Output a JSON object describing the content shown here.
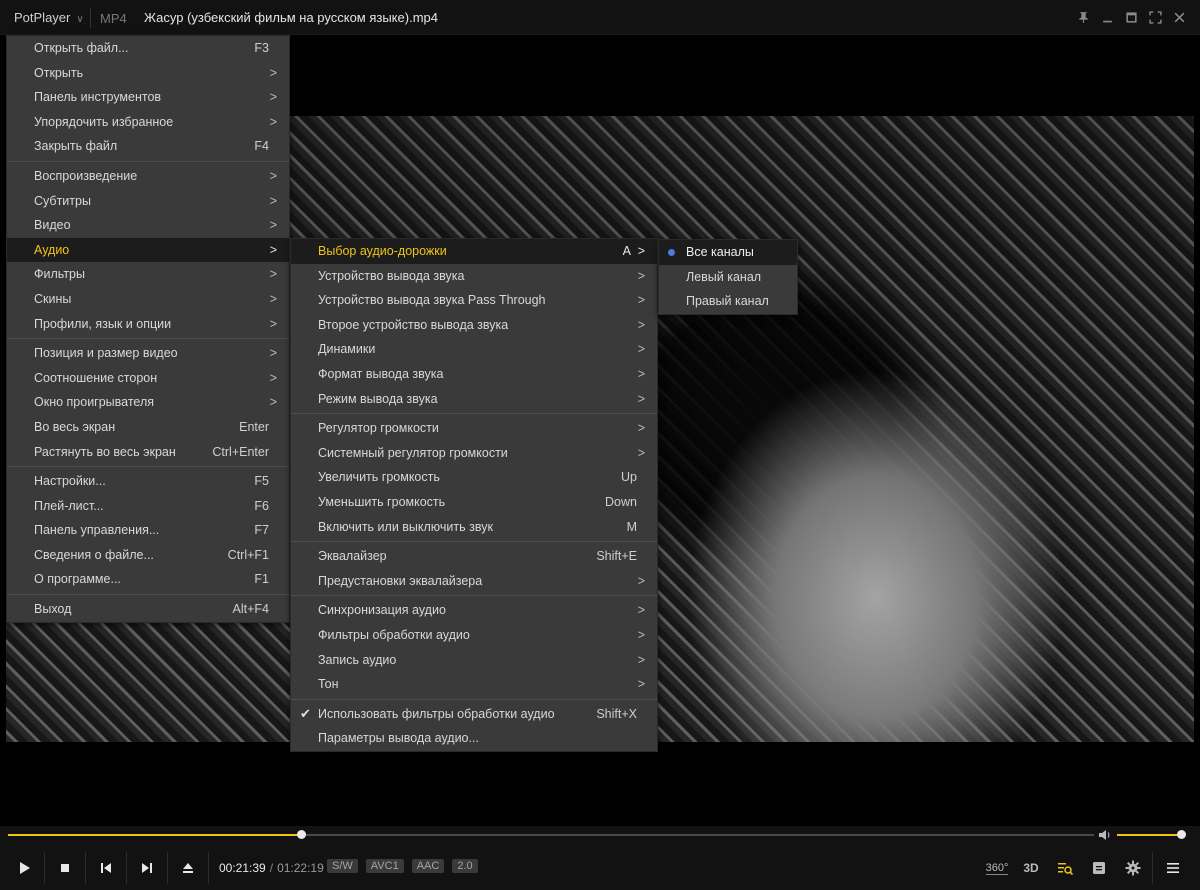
{
  "titlebar": {
    "app_name": "PotPlayer",
    "format": "MP4",
    "title": "Жасур (узбекский фильм на русском языке).mp4"
  },
  "main_menu": {
    "groups": [
      [
        {
          "label": "Открыть файл...",
          "shortcut": "F3"
        },
        {
          "label": "Открыть",
          "submenu": true
        },
        {
          "label": "Панель инструментов",
          "submenu": true
        },
        {
          "label": "Упорядочить избранное",
          "submenu": true
        },
        {
          "label": "Закрыть файл",
          "shortcut": "F4"
        }
      ],
      [
        {
          "label": "Воспроизведение",
          "submenu": true
        },
        {
          "label": "Субтитры",
          "submenu": true
        },
        {
          "label": "Видео",
          "submenu": true
        },
        {
          "label": "Аудио",
          "submenu": true,
          "active": true
        },
        {
          "label": "Фильтры",
          "submenu": true
        },
        {
          "label": "Скины",
          "submenu": true
        },
        {
          "label": "Профили, язык и опции",
          "submenu": true
        }
      ],
      [
        {
          "label": "Позиция и размер видео",
          "submenu": true
        },
        {
          "label": "Соотношение сторон",
          "submenu": true
        },
        {
          "label": "Окно проигрывателя",
          "submenu": true
        },
        {
          "label": "Во весь экран",
          "shortcut": "Enter"
        },
        {
          "label": "Растянуть во весь экран",
          "shortcut": "Ctrl+Enter"
        }
      ],
      [
        {
          "label": "Настройки...",
          "shortcut": "F5"
        },
        {
          "label": "Плей-лист...",
          "shortcut": "F6"
        },
        {
          "label": "Панель управления...",
          "shortcut": "F7"
        },
        {
          "label": "Сведения о файле...",
          "shortcut": "Ctrl+F1"
        },
        {
          "label": "О программе...",
          "shortcut": "F1"
        }
      ],
      [
        {
          "label": "Выход",
          "shortcut": "Alt+F4"
        }
      ]
    ]
  },
  "audio_menu": {
    "groups": [
      [
        {
          "label": "Выбор аудио-дорожки",
          "shortcut": "A",
          "submenu": true,
          "active": true
        },
        {
          "label": "Устройство вывода звука",
          "submenu": true
        },
        {
          "label": "Устройство вывода звука Pass Through",
          "submenu": true
        },
        {
          "label": "Второе устройство вывода звука",
          "submenu": true
        },
        {
          "label": "Динамики",
          "submenu": true
        },
        {
          "label": "Формат вывода звука",
          "submenu": true
        },
        {
          "label": "Режим вывода звука",
          "submenu": true
        }
      ],
      [
        {
          "label": "Регулятор громкости",
          "submenu": true
        },
        {
          "label": "Системный регулятор громкости",
          "submenu": true
        },
        {
          "label": "Увеличить громкость",
          "shortcut": "Up"
        },
        {
          "label": "Уменьшить громкость",
          "shortcut": "Down"
        },
        {
          "label": "Включить или выключить звук",
          "shortcut": "M"
        }
      ],
      [
        {
          "label": "Эквалайзер",
          "shortcut": "Shift+E"
        },
        {
          "label": "Предустановки эквалайзера",
          "submenu": true
        }
      ],
      [
        {
          "label": "Синхронизация аудио",
          "submenu": true
        },
        {
          "label": "Фильтры обработки аудио",
          "submenu": true
        },
        {
          "label": "Запись аудио",
          "submenu": true
        },
        {
          "label": "Тон",
          "submenu": true
        }
      ],
      [
        {
          "label": "Использовать фильтры обработки аудио",
          "shortcut": "Shift+X",
          "checked": true
        },
        {
          "label": "Параметры вывода аудио..."
        }
      ]
    ]
  },
  "channel_menu": {
    "items": [
      {
        "label": "Все каналы",
        "selected": true
      },
      {
        "label": "Левый канал"
      },
      {
        "label": "Правый канал"
      }
    ]
  },
  "controls": {
    "current_time": "00:21:39",
    "separator": "/",
    "total_time": "01:22:19",
    "progress_fraction": 0.27,
    "volume_fraction": 1.0,
    "badges": [
      "S/W",
      "AVC1",
      "AAC",
      "2.0"
    ],
    "label_360": "360°",
    "label_3d": "3D",
    "accent_color": "#f0c419"
  }
}
